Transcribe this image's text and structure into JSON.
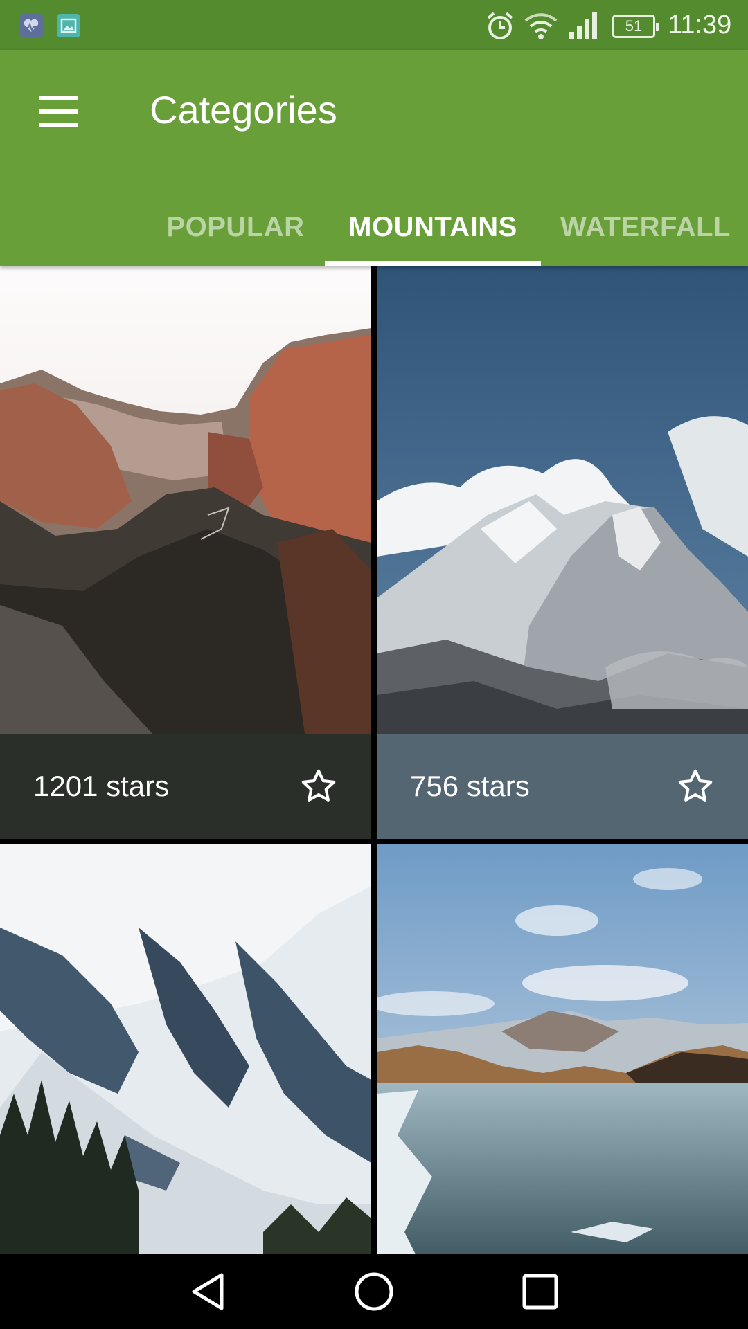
{
  "status_bar": {
    "notification_icons": [
      "health-app-icon",
      "gallery-app-icon"
    ],
    "system_icons": [
      "alarm-icon",
      "wifi-icon",
      "signal-icon",
      "battery-icon"
    ],
    "battery_level": "51",
    "time": "11:39"
  },
  "app_bar": {
    "title": "Categories",
    "menu_icon": "hamburger-menu-icon",
    "tabs": [
      {
        "label": "POPULAR",
        "active": false
      },
      {
        "label": "MOUNTAINS",
        "active": true
      },
      {
        "label": "WATERFALL",
        "active": false
      }
    ]
  },
  "grid": {
    "items": [
      {
        "stars": "1201 stars",
        "icon": "star-outline-icon",
        "caption_color": "#2b2f2a",
        "image": "canyon-mountain-photo"
      },
      {
        "stars": "756 stars",
        "icon": "star-outline-icon",
        "caption_color": "#546672",
        "image": "snowy-peak-photo"
      },
      {
        "image": "snowy-slopes-photo"
      },
      {
        "image": "frozen-lake-photo"
      }
    ]
  },
  "colors": {
    "primary": "#689f38",
    "primary_dark": "#558b2f",
    "tab_inactive": "rgba(255,255,255,0.55)"
  },
  "nav_bar": {
    "buttons": [
      "back-icon",
      "home-icon",
      "recents-icon"
    ]
  }
}
